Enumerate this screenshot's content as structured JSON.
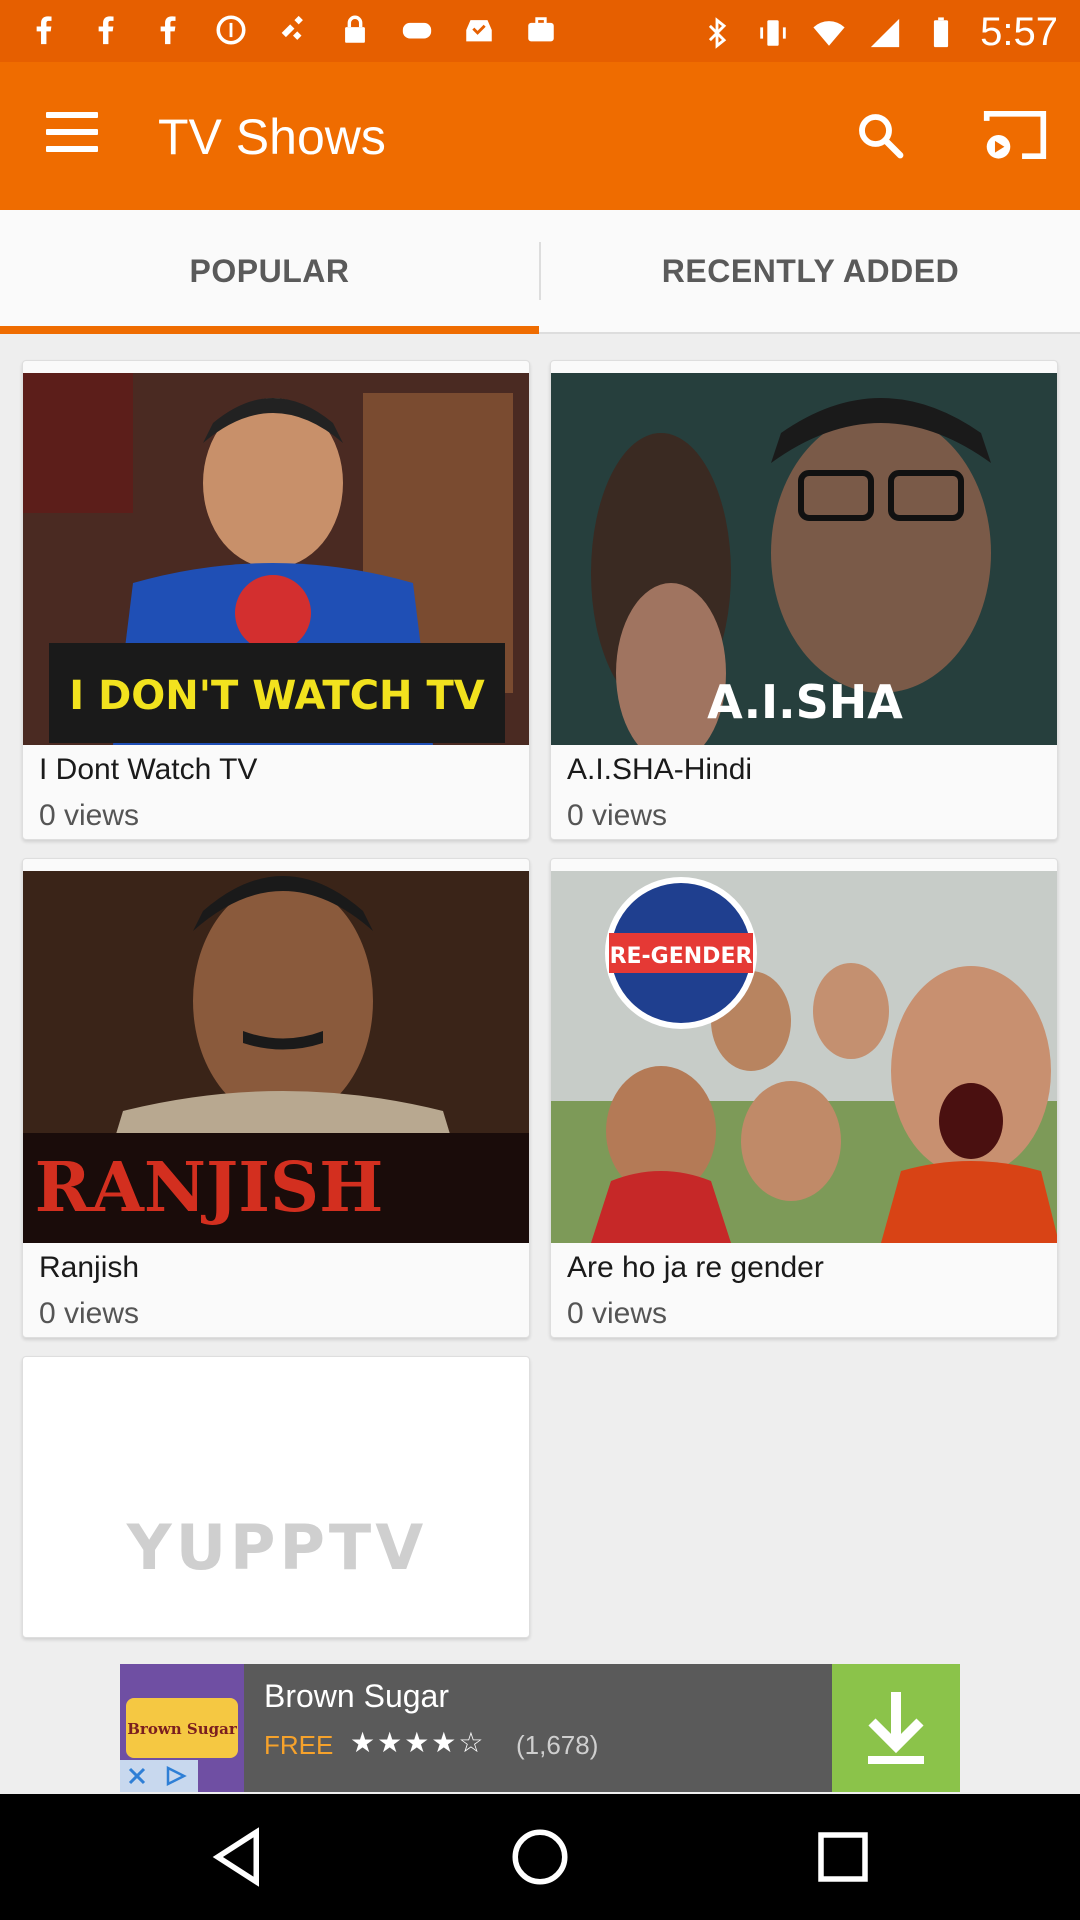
{
  "status_bar": {
    "time": "5:57",
    "left_icons": [
      "facebook-icon",
      "facebook-icon",
      "facebook-icon",
      "pinterest-icon",
      "satellite-icon",
      "lock-icon",
      "game-controller-icon",
      "inbox-icon",
      "briefcase-icon"
    ],
    "right_icons": [
      "bluetooth-icon",
      "vibrate-icon",
      "wifi-icon",
      "signal-icon",
      "battery-icon"
    ]
  },
  "app_bar": {
    "title": "TV Shows",
    "color": "#ef6c00"
  },
  "tabs": [
    {
      "label": "POPULAR",
      "active": true
    },
    {
      "label": "RECENTLY ADDED",
      "active": false
    }
  ],
  "shows": [
    {
      "title": "I Dont Watch TV",
      "views": "0 views",
      "thumb_caption": "I DON'T WATCH TV"
    },
    {
      "title": "A.I.SHA-Hindi",
      "views": "0 views",
      "thumb_caption": "A.I.SHA"
    },
    {
      "title": "Ranjish",
      "views": "0 views",
      "thumb_caption": "RANJISH"
    },
    {
      "title": "Are ho ja re gender",
      "views": "0 views",
      "thumb_caption": "RE-GENDER"
    }
  ],
  "placeholder_card": {
    "logo_text": "YUPPTV"
  },
  "ad": {
    "logo_text": "Brown Sugar",
    "title": "Brown Sugar",
    "price": "FREE",
    "stars": "★★★★☆",
    "rating_count": "(1,678)"
  },
  "nav_bar": {
    "buttons": [
      "back-icon",
      "home-icon",
      "recents-icon"
    ]
  }
}
